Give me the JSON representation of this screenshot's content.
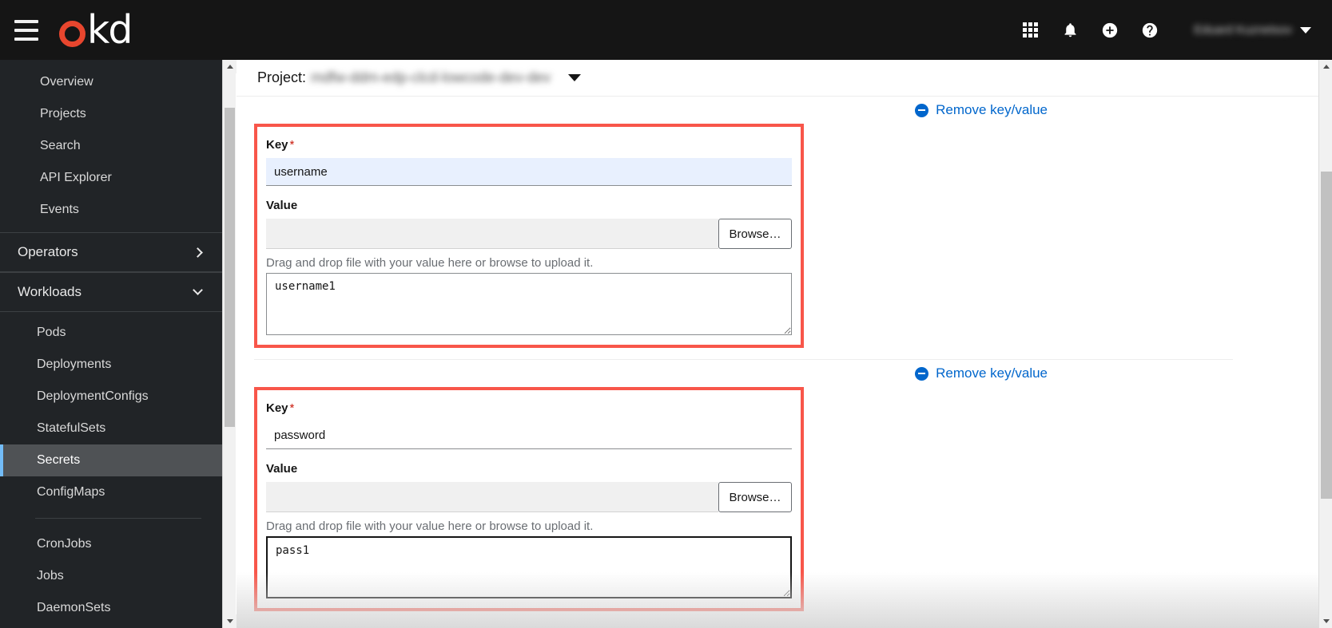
{
  "masthead": {
    "logo_o": "o",
    "logo_kd": "kd",
    "icons": [
      {
        "name": "apps-grid-icon",
        "label": "Application launcher"
      },
      {
        "name": "bell-icon",
        "label": "Notifications"
      },
      {
        "name": "plus-circle-icon",
        "label": "Quick create"
      },
      {
        "name": "question-circle-icon",
        "label": "Help"
      }
    ],
    "user_name": "Eduard Kuznetsov",
    "hamburger_label": "Toggle navigation"
  },
  "sidebar": {
    "top_items": [
      {
        "label": "Overview",
        "active": false
      },
      {
        "label": "Projects",
        "active": false
      },
      {
        "label": "Search",
        "active": false
      },
      {
        "label": "API Explorer",
        "active": false
      },
      {
        "label": "Events",
        "active": false
      }
    ],
    "groups": [
      {
        "label": "Operators",
        "expanded": false,
        "chevron": "chevron-right-icon"
      },
      {
        "label": "Workloads",
        "expanded": true,
        "chevron": "chevron-down-icon"
      }
    ],
    "workload_items_a": [
      {
        "label": "Pods",
        "active": false
      },
      {
        "label": "Deployments",
        "active": false
      },
      {
        "label": "DeploymentConfigs",
        "active": false
      },
      {
        "label": "StatefulSets",
        "active": false
      },
      {
        "label": "Secrets",
        "active": true
      },
      {
        "label": "ConfigMaps",
        "active": false
      }
    ],
    "workload_items_b": [
      {
        "label": "CronJobs",
        "active": false
      },
      {
        "label": "Jobs",
        "active": false
      },
      {
        "label": "DaemonSets",
        "active": false
      }
    ]
  },
  "project_bar": {
    "label": "Project:",
    "project_name": "mdfw-ddm-edp-clcd-lowcode-dev-dev",
    "caret": "caret-down-icon"
  },
  "form": {
    "remove_link_label": "Remove key/value",
    "key_label": "Key",
    "required_mark": "*",
    "value_label": "Value",
    "browse_label": "Browse…",
    "helper_text": "Drag and drop file with your value here or browse to upload it.",
    "file_placeholder": "",
    "entries": [
      {
        "key": "username",
        "key_autofilled": true,
        "file_name": "",
        "value": "username1",
        "value_focused": false
      },
      {
        "key": "password",
        "key_autofilled": false,
        "file_name": "",
        "value": "pass1",
        "value_focused": true
      }
    ]
  },
  "colors": {
    "masthead_bg": "#151515",
    "sidebar_bg": "#212427",
    "active_accent": "#73bcf7",
    "highlight_border": "#f8564a",
    "link_blue": "#0066cc",
    "brand_red": "#e8462e",
    "autofill_blue": "#e8f0fe"
  }
}
